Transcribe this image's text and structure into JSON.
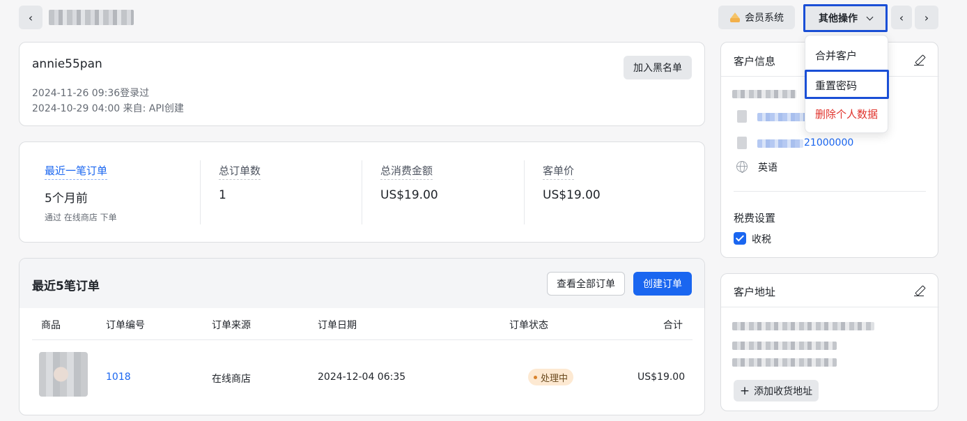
{
  "topbar": {
    "vip_label": "会员系统",
    "ops_label": "其他操作"
  },
  "dropdown": {
    "items": [
      "合并客户",
      "重置密码",
      "删除个人数据"
    ]
  },
  "customer": {
    "name": "annie55pan",
    "last_login": "2024-11-26 09:36登录过",
    "created": "2024-10-29 04:00  来自: API创建",
    "blacklist_label": "加入黑名单"
  },
  "stats": [
    {
      "label": "最近一笔订单",
      "value": "5个月前",
      "sub": "通过 在线商店 下单"
    },
    {
      "label": "总订单数",
      "value": "1"
    },
    {
      "label": "总消费金额",
      "value": "US$19.00"
    },
    {
      "label": "客单价",
      "value": "US$19.00"
    }
  ],
  "orders": {
    "title": "最近5笔订单",
    "view_all_label": "查看全部订单",
    "create_label": "创建订单",
    "columns": [
      "商品",
      "订单编号",
      "订单来源",
      "订单日期",
      "订单状态",
      "合计"
    ],
    "rows": [
      {
        "number": "1018",
        "source": "在线商店",
        "date": "2024-12-04 06:35",
        "status": "处理中",
        "total": "US$19.00"
      }
    ]
  },
  "info_panel": {
    "title": "客户信息",
    "phone_suffix": "21000000",
    "language": "英语",
    "tax_title": "税费设置",
    "tax_option": "收税"
  },
  "address_panel": {
    "title": "客户地址",
    "add_label": "添加收货地址"
  },
  "colors": {
    "accent": "#1a66f0",
    "highlight_border": "#1a4fd6",
    "danger": "#e0332c",
    "badge_bg": "#fde9d2"
  }
}
